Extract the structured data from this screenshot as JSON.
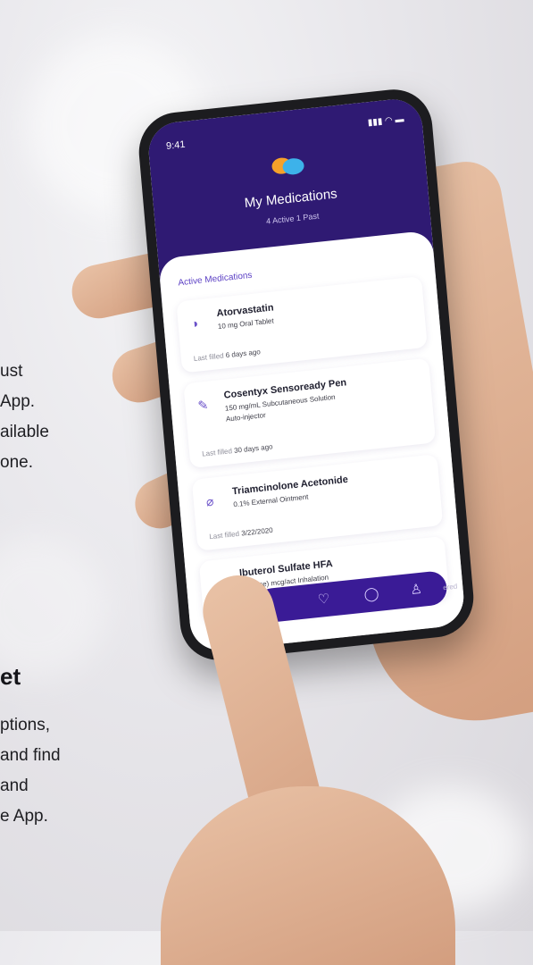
{
  "left_text_top": [
    "ust",
    "App.",
    "ailable",
    "one."
  ],
  "heading": "et",
  "left_text_bottom": [
    "ptions,",
    "and find",
    "and",
    "e App."
  ],
  "phone": {
    "time": "9:41",
    "status_icons": "signal-wifi-battery",
    "title": "My Medications",
    "subtitle": "4 Active  1 Past",
    "section_title": "Active Medications",
    "medications": [
      {
        "name": "Atorvastatin",
        "desc": "10 mg Oral Tablet",
        "desc2": "",
        "last_label": "Last filled",
        "last_value": "6 days ago",
        "icon": "pill-icon"
      },
      {
        "name": "Cosentyx Sensoready Pen",
        "desc": "150 mg/mL Subcutaneous Solution",
        "desc2": "Auto-injector",
        "last_label": "Last filled",
        "last_value": "30 days ago",
        "icon": "syringe-icon"
      },
      {
        "name": "Triamcinolone Acetonide",
        "desc": "0.1% External Ointment",
        "desc2": "",
        "last_label": "Last filled",
        "last_value": "3/22/2020",
        "icon": "tube-icon"
      },
      {
        "name": "lbuterol Sulfate HFA",
        "desc": "90 Base) mcg/act Inhalation",
        "desc2": "",
        "last_label": "",
        "last_value": "",
        "icon": "inhaler-icon"
      }
    ],
    "tabbar_partial_text": "ered",
    "colors": {
      "header": "#2f1a73",
      "accent": "#5b3fc4",
      "tabbar": "#3a1b96"
    }
  }
}
